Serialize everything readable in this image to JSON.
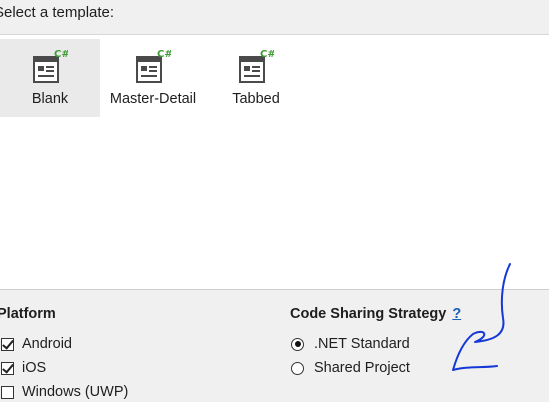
{
  "header": {
    "label": "Select a template:"
  },
  "templates": [
    {
      "label": "Blank",
      "selected": true,
      "icon": "csharp-template-icon"
    },
    {
      "label": "Master-Detail",
      "selected": false,
      "icon": "csharp-template-icon"
    },
    {
      "label": "Tabbed",
      "selected": false,
      "icon": "csharp-template-icon"
    }
  ],
  "platform": {
    "title": "Platform",
    "options": [
      {
        "label": "Android",
        "checked": true
      },
      {
        "label": "iOS",
        "checked": true
      },
      {
        "label": "Windows (UWP)",
        "checked": false
      }
    ]
  },
  "code_sharing": {
    "title": "Code Sharing Strategy",
    "help": "?",
    "options": [
      {
        "label": ".NET Standard",
        "selected": true
      },
      {
        "label": "Shared Project",
        "selected": false
      }
    ]
  },
  "colors": {
    "icon_dark": "#4a4a4a",
    "csharp_green": "#3f9c35",
    "link_blue": "#1a5fb4",
    "annotation_blue": "#1538d6"
  }
}
